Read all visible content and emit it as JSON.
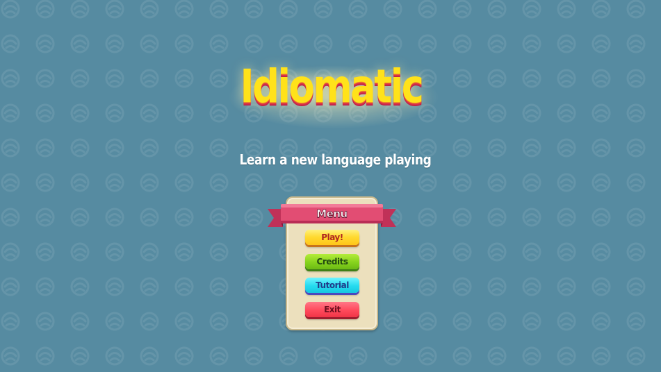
{
  "game": {
    "title": "Idiomatic",
    "subtitle": "Learn a new language playing"
  },
  "menu": {
    "header": "Menu",
    "buttons": [
      {
        "label": "Play!",
        "color": "#ffd92e"
      },
      {
        "label": "Credits",
        "color": "#86d21d"
      },
      {
        "label": "Tutorial",
        "color": "#25dbef"
      },
      {
        "label": "Exit",
        "color": "#ff4a5c"
      }
    ]
  },
  "colors": {
    "background": "#568ba1",
    "title_fill": "#ffe21a",
    "title_shadow": "#c9284b",
    "ribbon": "#e24d73",
    "panel": "#ece0bd"
  }
}
